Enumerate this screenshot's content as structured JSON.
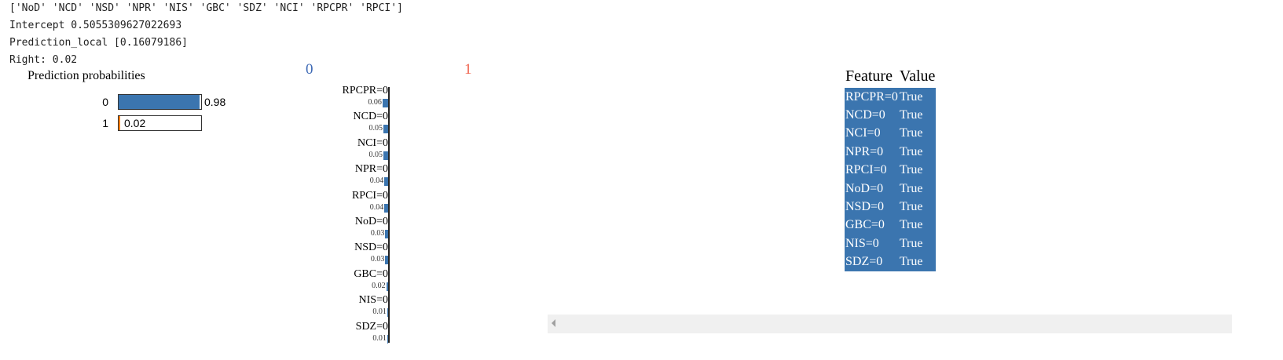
{
  "output": {
    "features_line": "['NoD' 'NCD' 'NSD' 'NPR' 'NIS' 'GBC' 'SDZ' 'NCI' 'RPCPR' 'RPCI']",
    "intercept_line": "Intercept 0.5055309627022693",
    "prediction_line": "Prediction_local [0.16079186]",
    "right_line": "Right: 0.02"
  },
  "probabilities": {
    "title": "Prediction probabilities",
    "rows": [
      {
        "label": "0",
        "value": 0.98,
        "value_text": "0.98",
        "color": "#3b75af"
      },
      {
        "label": "1",
        "value": 0.02,
        "value_text": "0.02",
        "color": "#ff7f0e"
      }
    ]
  },
  "weights": {
    "class0": "0",
    "class1": "1",
    "bar_color": "#3b75af",
    "items": [
      {
        "feature": "RPCPR=0",
        "weight": 0.06,
        "weight_text": "0.06"
      },
      {
        "feature": "NCD=0",
        "weight": 0.05,
        "weight_text": "0.05"
      },
      {
        "feature": "NCI=0",
        "weight": 0.05,
        "weight_text": "0.05"
      },
      {
        "feature": "NPR=0",
        "weight": 0.04,
        "weight_text": "0.04"
      },
      {
        "feature": "RPCI=0",
        "weight": 0.04,
        "weight_text": "0.04"
      },
      {
        "feature": "NoD=0",
        "weight": 0.03,
        "weight_text": "0.03"
      },
      {
        "feature": "NSD=0",
        "weight": 0.03,
        "weight_text": "0.03"
      },
      {
        "feature": "GBC=0",
        "weight": 0.02,
        "weight_text": "0.02"
      },
      {
        "feature": "NIS=0",
        "weight": 0.01,
        "weight_text": "0.01"
      },
      {
        "feature": "SDZ=0",
        "weight": 0.01,
        "weight_text": "0.01"
      }
    ]
  },
  "table": {
    "headers": [
      "Feature",
      "Value"
    ],
    "rows": [
      [
        "RPCPR=0",
        "True"
      ],
      [
        "NCD=0",
        "True"
      ],
      [
        "NCI=0",
        "True"
      ],
      [
        "NPR=0",
        "True"
      ],
      [
        "RPCI=0",
        "True"
      ],
      [
        "NoD=0",
        "True"
      ],
      [
        "NSD=0",
        "True"
      ],
      [
        "GBC=0",
        "True"
      ],
      [
        "NIS=0",
        "True"
      ],
      [
        "SDZ=0",
        "True"
      ]
    ]
  }
}
